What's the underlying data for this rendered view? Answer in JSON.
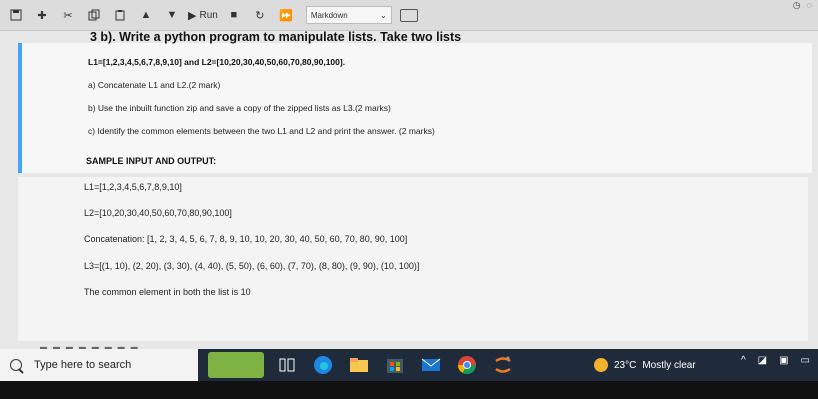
{
  "toolbar": {
    "run_label": "Run",
    "cell_type": "Markdown"
  },
  "question": {
    "title": "3 b). Write a python program to manipulate lists. Take two lists",
    "lists": "L1=[1,2,3,4,5,6,7,8,9,10] and L2=[10,20,30,40,50,60,70,80,90,100].",
    "a": "a) Concatenate L1 and L2.(2 mark)",
    "b": "b) Use the inbuilt function zip and save a copy of the zipped lists as L3.(2 marks)",
    "c": "c) Identify the common elements between the two L1 and L2 and print the answer. (2 marks)"
  },
  "sample": {
    "heading": "SAMPLE INPUT AND OUTPUT:",
    "l1": "L1=[1,2,3,4,5,6,7,8,9,10]",
    "l2": "L2=[10,20,30,40,50,60,70,80,90,100]",
    "concat": "Concatenation: [1, 2, 3, 4, 5, 6, 7, 8, 9, 10, 10, 20, 30, 40, 50, 60, 70, 80, 90, 100]",
    "l3": "L3=[(1, 10), (2, 20), (3, 30), (4, 40), (5, 50), (6, 60), (7, 70), (8, 80), (9, 90), (10, 100)]",
    "common": "The common element in both the list is 10"
  },
  "taskbar": {
    "search_placeholder": "Type here to search",
    "weather_temp": "23°C",
    "weather_desc": "Mostly clear"
  },
  "colors": {
    "accent": "#42a5f5",
    "taskbar": "#1f2b3a"
  }
}
